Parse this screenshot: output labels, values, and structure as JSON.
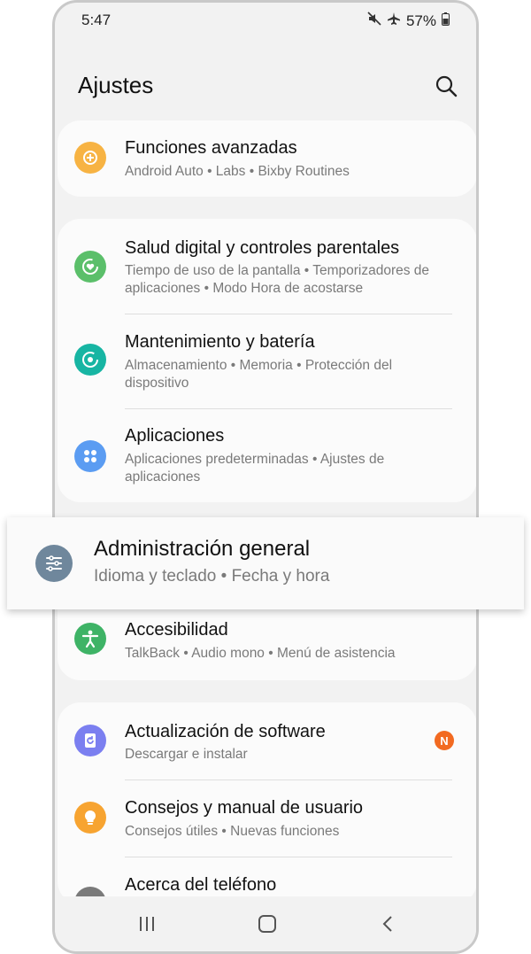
{
  "status_bar": {
    "time": "5:47",
    "battery": "57%"
  },
  "header": {
    "title": "Ajustes"
  },
  "items": {
    "advanced": {
      "title": "Funciones avanzadas",
      "sub": "Android Auto  •  Labs  •  Bixby Routines"
    },
    "digital": {
      "title": "Salud digital y controles parentales",
      "sub": "Tiempo de uso de la pantalla  •  Temporizadores de aplicaciones  •  Modo Hora de acostarse"
    },
    "maintenance": {
      "title": "Mantenimiento y batería",
      "sub": "Almacenamiento  •  Memoria  •  Protección del dispositivo"
    },
    "apps": {
      "title": "Aplicaciones",
      "sub": "Aplicaciones predeterminadas  •  Ajustes de aplicaciones"
    },
    "general": {
      "title": "Administración general",
      "sub": "Idioma y teclado  •  Fecha y hora"
    },
    "accessibility": {
      "title": "Accesibilidad",
      "sub": "TalkBack  •  Audio mono  •  Menú de asistencia"
    },
    "update": {
      "title": "Actualización de software",
      "sub": "Descargar e instalar",
      "badge": "N"
    },
    "tips": {
      "title": "Consejos y manual de usuario",
      "sub": "Consejos útiles  •  Nuevas funciones"
    },
    "about": {
      "title": "Acerca del teléfono"
    }
  },
  "colors": {
    "advanced": "#f7b343",
    "digital": "#5bbf6a",
    "maintenance": "#17b5a3",
    "apps": "#5b9cf2",
    "general": "#6f879c",
    "accessibility": "#3eb366",
    "update": "#7b7ff0",
    "tips": "#f7a431",
    "about": "#7a7a7a"
  }
}
